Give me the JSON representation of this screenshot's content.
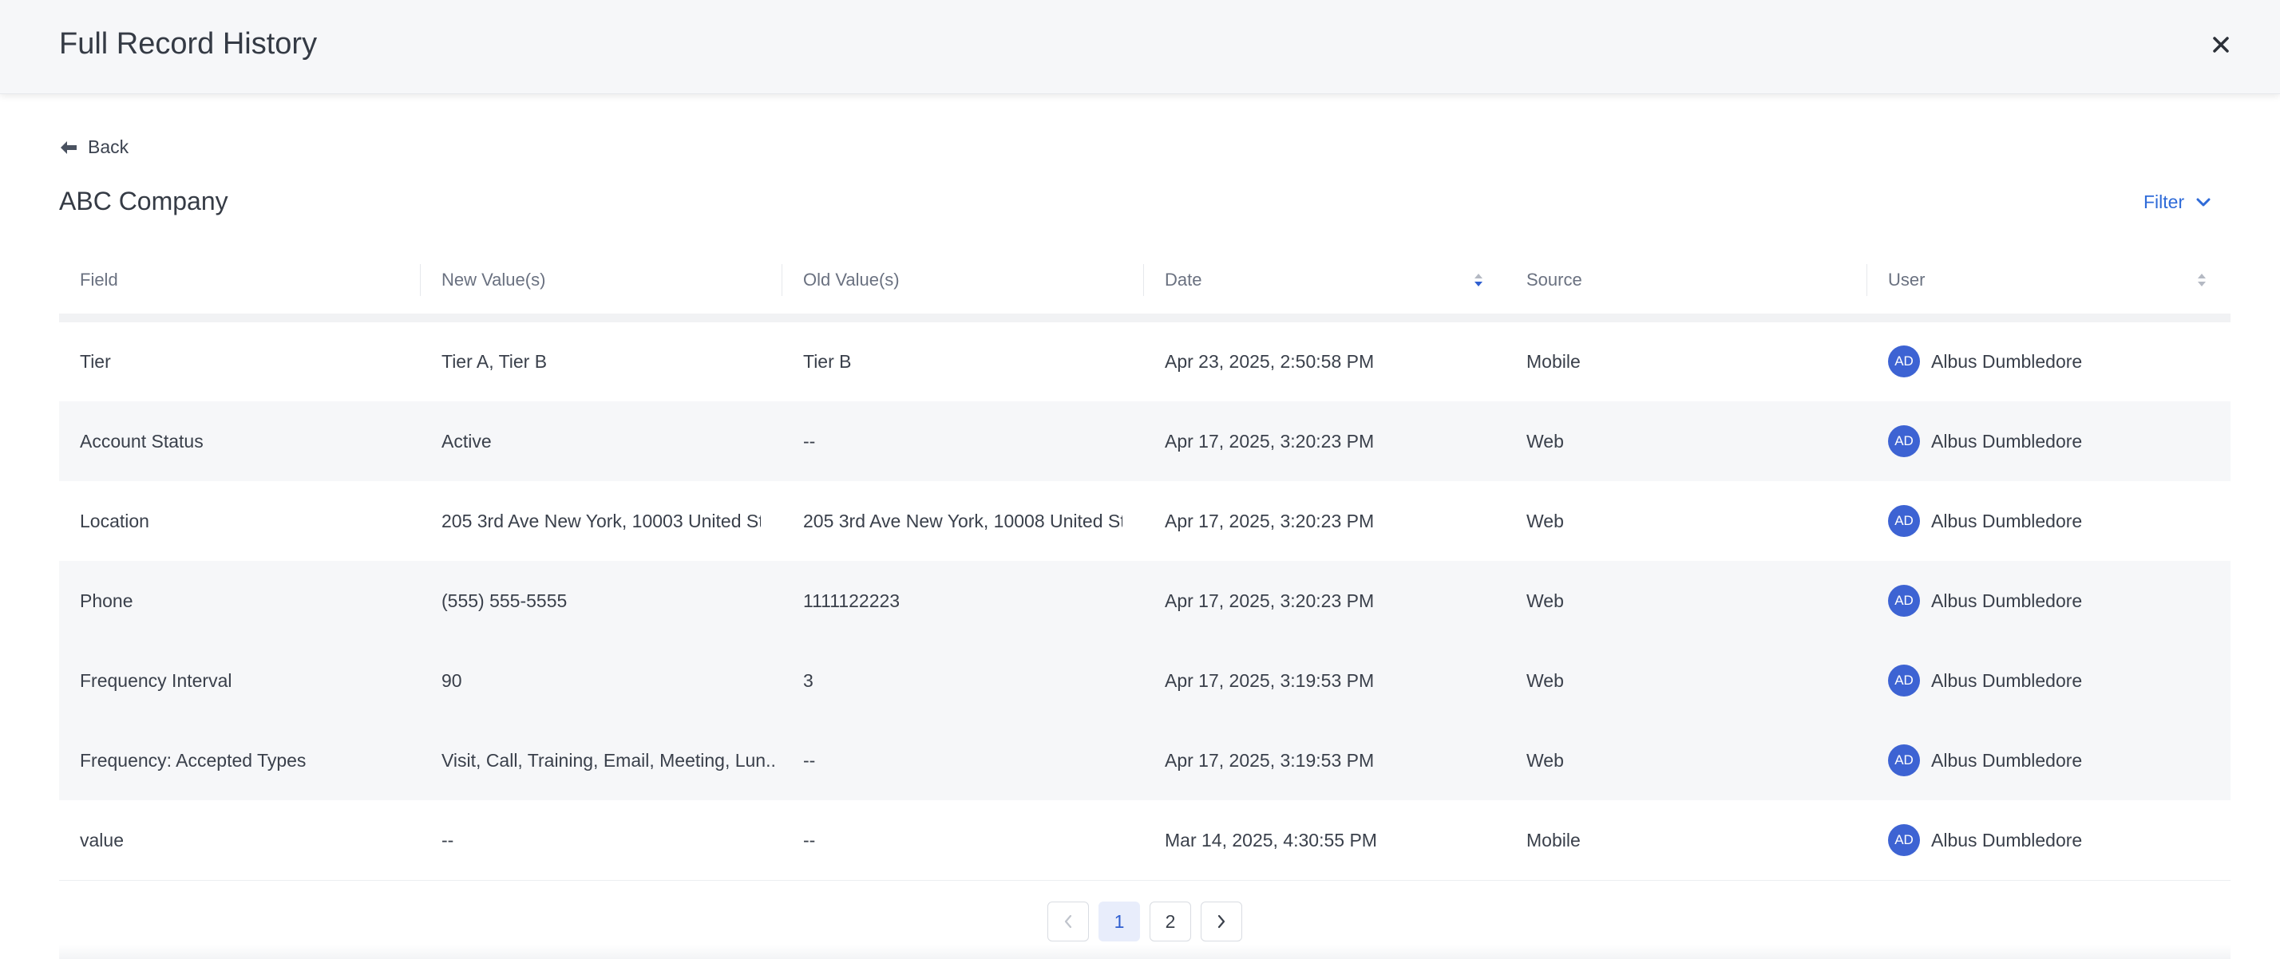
{
  "modal": {
    "title": "Full Record History"
  },
  "back_label": "Back",
  "company_name": "ABC Company",
  "filter_label": "Filter",
  "columns": [
    "Field",
    "New Value(s)",
    "Old Value(s)",
    "Date",
    "Source",
    "User"
  ],
  "rows": [
    {
      "field": "Tier",
      "new": "Tier A, Tier B",
      "old": "Tier B",
      "date": "Apr 23, 2025, 2:50:58 PM",
      "source": "Mobile",
      "initials": "AD",
      "user": "Albus Dumbledore"
    },
    {
      "field": "Account Status",
      "new": "Active",
      "old": "--",
      "date": "Apr 17, 2025, 3:20:23 PM",
      "source": "Web",
      "initials": "AD",
      "user": "Albus Dumbledore"
    },
    {
      "field": "Location",
      "new": "205 3rd Ave New York, 10003 United Sta",
      "old": "205 3rd Ave New York, 10008 United Sta",
      "date": "Apr 17, 2025, 3:20:23 PM",
      "source": "Web",
      "initials": "AD",
      "user": "Albus Dumbledore"
    },
    {
      "field": "Phone",
      "new": "(555) 555-5555",
      "old": "1111122223",
      "date": "Apr 17, 2025, 3:20:23 PM",
      "source": "Web",
      "initials": "AD",
      "user": "Albus Dumbledore"
    },
    {
      "field": "Frequency Interval",
      "new": "90",
      "old": "3",
      "date": "Apr 17, 2025, 3:19:53 PM",
      "source": "Web",
      "initials": "AD",
      "user": "Albus Dumbledore"
    },
    {
      "field": "Frequency: Accepted Types",
      "new": "Visit, Call, Training, Email, Meeting, Lun...",
      "old": "--",
      "date": "Apr 17, 2025, 3:19:53 PM",
      "source": "Web",
      "initials": "AD",
      "user": "Albus Dumbledore"
    },
    {
      "field": "value",
      "new": "--",
      "old": "--",
      "date": "Mar 14, 2025, 4:30:55 PM",
      "source": "Mobile",
      "initials": "AD",
      "user": "Albus Dumbledore"
    }
  ],
  "pagination": {
    "pages": [
      "1",
      "2"
    ],
    "current": "1"
  },
  "colors": {
    "accent": "#2f6bd8",
    "avatar": "#3d63d3",
    "alt_row": "#f6f7f9"
  }
}
